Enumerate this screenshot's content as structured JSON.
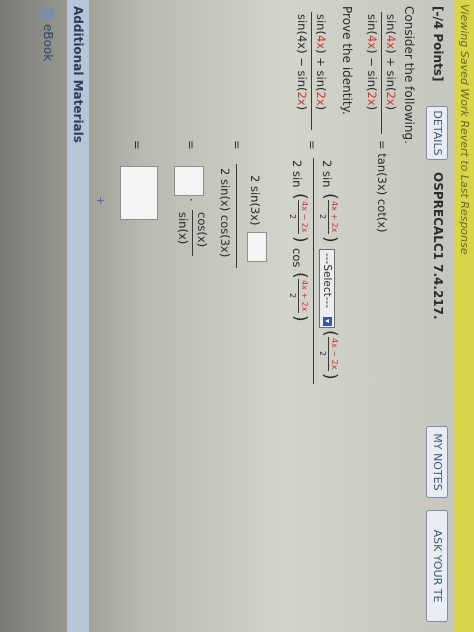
{
  "banner": {
    "text": "Viewing Saved Work Revert to Last Response"
  },
  "header": {
    "points": "[-/4 Points]",
    "details_label": "DETAILS",
    "course_code": "OSPRECALC1 7.4.217.",
    "my_notes_label": "MY NOTES",
    "ask_label": "ASK YOUR TE"
  },
  "problem": {
    "consider": "Consider the following.",
    "prove": "Prove the identity.",
    "given": {
      "num_a": "sin(",
      "num_b": "4x",
      "num_c": ") + sin(",
      "num_d": "2x",
      "num_e": ")",
      "den_a": "sin(",
      "den_b": "4x",
      "den_c": ") − sin(",
      "den_d": "2x",
      "den_e": ")",
      "rhs": "= tan(3x) cot(x)"
    },
    "step1": {
      "lhs_num_a": "sin(",
      "lhs_num_b": "4x",
      "lhs_num_c": ") + sin(",
      "lhs_num_d": "2x",
      "lhs_num_e": ")",
      "lhs_den_a": "sin(4x) − sin(",
      "lhs_den_b": "2x",
      "lhs_den_c": ")",
      "eq": "=",
      "num_coef": "2 sin",
      "half_num1": "4x + 2x",
      "half_den1": "2",
      "select_label": "---Select---",
      "half_num2": "4x − 2x",
      "half_den2": "2",
      "den_coef": "2 sin",
      "half_num3": "4x − 2x",
      "half_den3": "2",
      "cos_label": "cos",
      "half_num4": "4x + 2x",
      "half_den4": "2"
    },
    "step2": {
      "eq": "=",
      "num": "2 sin(3x)",
      "den": "2 sin(x) cos(3x)"
    },
    "step3": {
      "eq": "=",
      "dot": "·",
      "frac_num": "cos(x)",
      "frac_den": "sin(x)"
    },
    "step4": {
      "eq": "="
    }
  },
  "footer": {
    "plus": "+",
    "additional_materials": "Additional Materials",
    "ebook": "eBook"
  },
  "colors": {
    "banner": "#d8d54a",
    "highlight": "#c83c32",
    "button_text": "#3b5775"
  }
}
